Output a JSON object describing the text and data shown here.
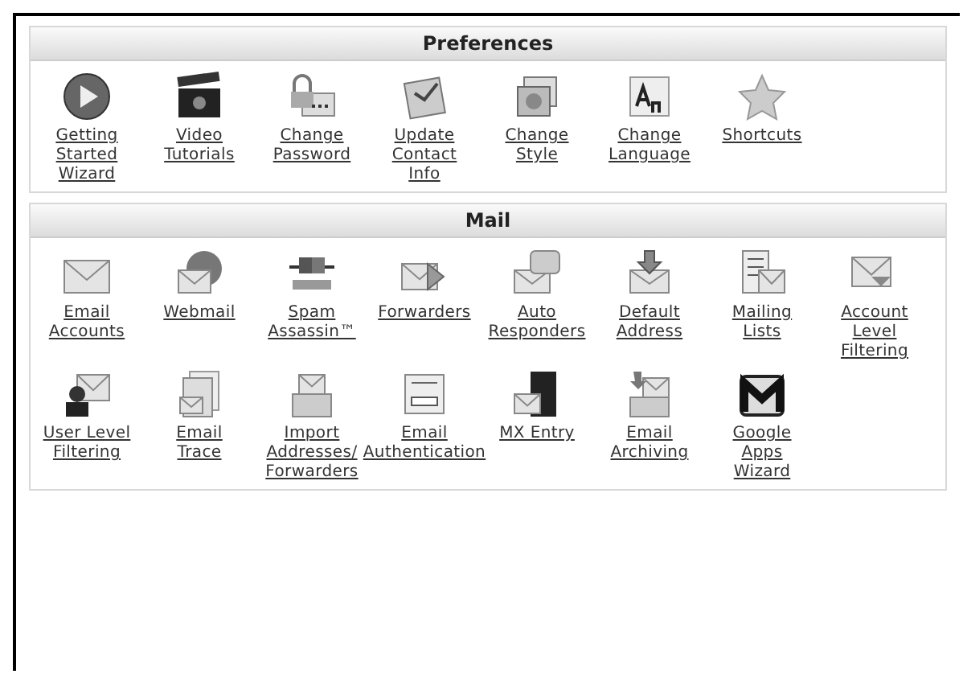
{
  "panels": [
    {
      "title": "Preferences",
      "items": [
        {
          "kind": "play",
          "lines": [
            "Getting",
            "Started",
            "Wizard"
          ]
        },
        {
          "kind": "clapper",
          "lines": [
            "Video",
            "Tutorials"
          ]
        },
        {
          "kind": "padlock",
          "lines": [
            "Change",
            "Password"
          ]
        },
        {
          "kind": "notepad",
          "lines": [
            "Update",
            "Contact",
            "Info"
          ]
        },
        {
          "kind": "pictures",
          "lines": [
            "Change",
            "Style"
          ]
        },
        {
          "kind": "letters",
          "lines": [
            "Change",
            "Language"
          ]
        },
        {
          "kind": "star",
          "lines": [
            "Shortcuts"
          ]
        }
      ]
    },
    {
      "title": "Mail",
      "items": [
        {
          "kind": "envelope",
          "lines": [
            "Email",
            "Accounts"
          ]
        },
        {
          "kind": "globe",
          "lines": [
            "Webmail"
          ]
        },
        {
          "kind": "spam",
          "lines": [
            "Spam",
            "Assassin™"
          ]
        },
        {
          "kind": "forward",
          "lines": [
            "Forwarders"
          ]
        },
        {
          "kind": "bubble",
          "lines": [
            "Auto",
            "Responders"
          ]
        },
        {
          "kind": "download",
          "lines": [
            "Default",
            "Address"
          ]
        },
        {
          "kind": "list",
          "lines": [
            "Mailing",
            "Lists"
          ]
        },
        {
          "kind": "filter",
          "lines": [
            "Account",
            "Level",
            "Filtering"
          ]
        },
        {
          "kind": "person",
          "lines": [
            "User Level",
            "Filtering"
          ]
        },
        {
          "kind": "documents",
          "lines": [
            "Email",
            "Trace"
          ]
        },
        {
          "kind": "box",
          "lines": [
            "Import",
            "Addresses/",
            "Forwarders"
          ]
        },
        {
          "kind": "form",
          "lines": [
            "Email",
            "Authentication"
          ]
        },
        {
          "kind": "server",
          "lines": [
            "MX Entry"
          ]
        },
        {
          "kind": "archive",
          "lines": [
            "Email",
            "Archiving"
          ]
        },
        {
          "kind": "gmail",
          "lines": [
            "Google",
            "Apps",
            "Wizard"
          ]
        }
      ]
    }
  ]
}
